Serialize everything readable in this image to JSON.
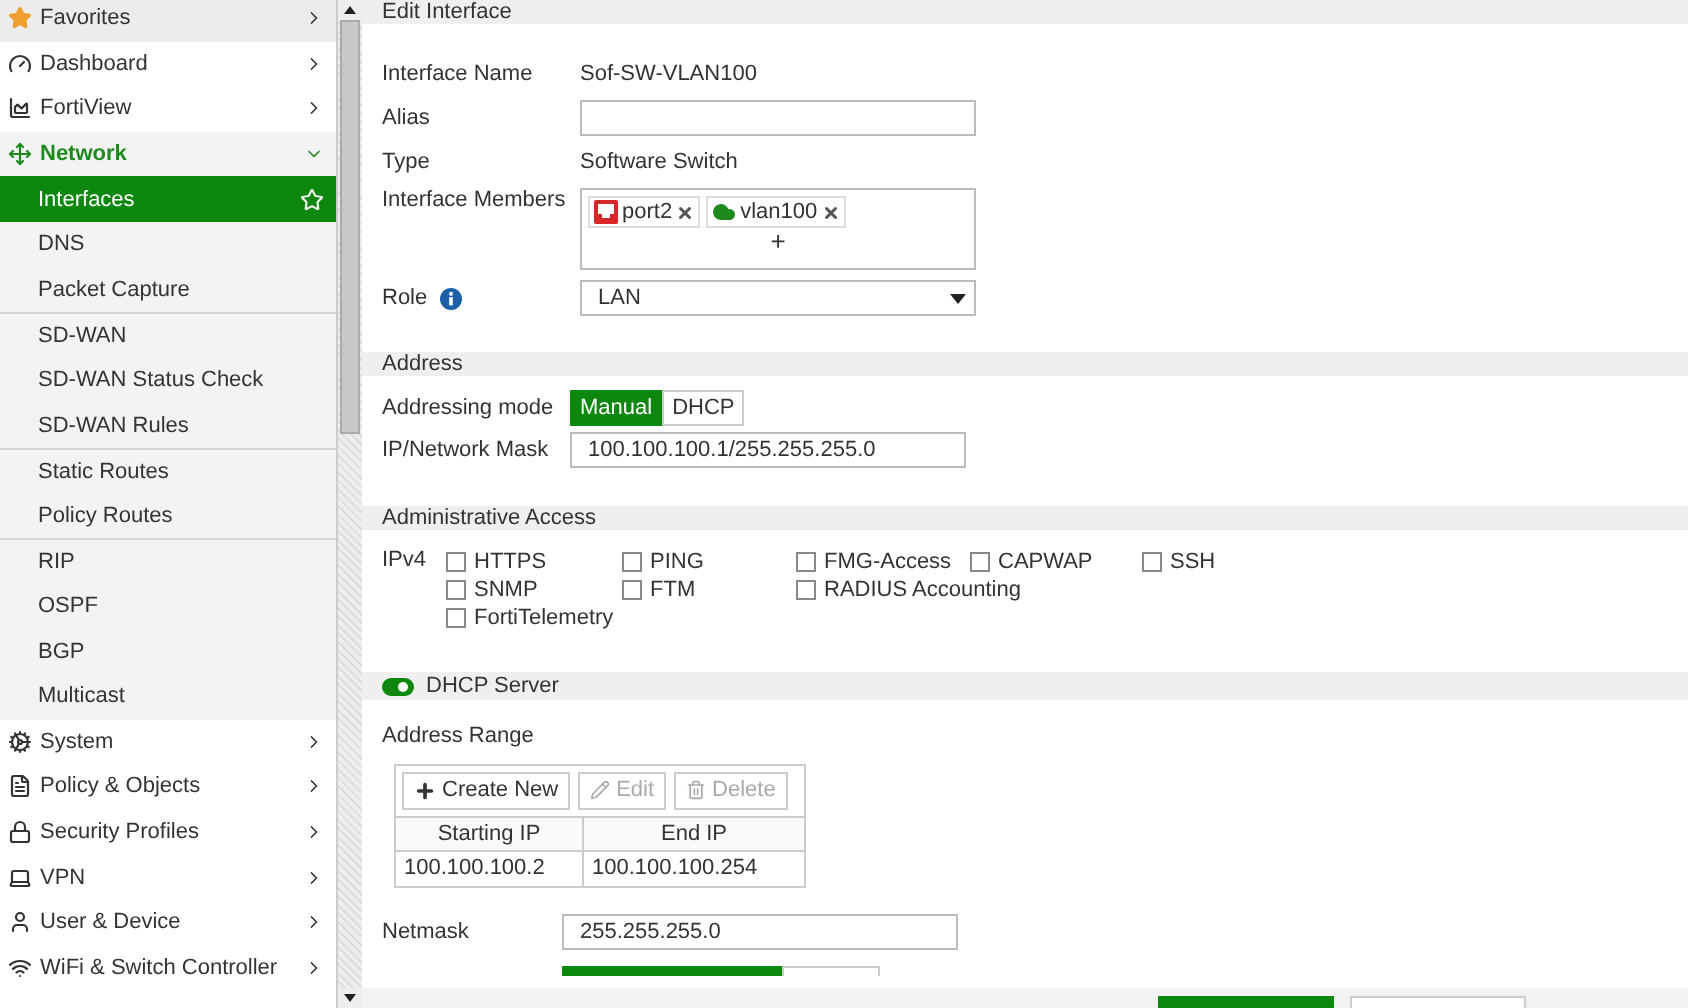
{
  "sidebar": {
    "items": [
      {
        "label": "Favorites",
        "kind": "favorites",
        "expanded": false
      },
      {
        "label": "Dashboard",
        "kind": "menu",
        "expanded": false
      },
      {
        "label": "FortiView",
        "kind": "menu",
        "expanded": false
      },
      {
        "label": "Network",
        "kind": "menu",
        "expanded": true,
        "children": [
          {
            "label": "Interfaces",
            "selected": true,
            "divider_before": false
          },
          {
            "label": "DNS",
            "selected": false,
            "divider_before": false
          },
          {
            "label": "Packet Capture",
            "selected": false,
            "divider_before": false
          },
          {
            "label": "SD-WAN",
            "selected": false,
            "divider_before": true
          },
          {
            "label": "SD-WAN Status Check",
            "selected": false,
            "divider_before": false
          },
          {
            "label": "SD-WAN Rules",
            "selected": false,
            "divider_before": false
          },
          {
            "label": "Static Routes",
            "selected": false,
            "divider_before": true
          },
          {
            "label": "Policy Routes",
            "selected": false,
            "divider_before": false
          },
          {
            "label": "RIP",
            "selected": false,
            "divider_before": true
          },
          {
            "label": "OSPF",
            "selected": false,
            "divider_before": false
          },
          {
            "label": "BGP",
            "selected": false,
            "divider_before": false
          },
          {
            "label": "Multicast",
            "selected": false,
            "divider_before": false
          }
        ]
      },
      {
        "label": "System",
        "kind": "menu",
        "expanded": false
      },
      {
        "label": "Policy & Objects",
        "kind": "menu",
        "expanded": false
      },
      {
        "label": "Security Profiles",
        "kind": "menu",
        "expanded": false
      },
      {
        "label": "VPN",
        "kind": "menu",
        "expanded": false
      },
      {
        "label": "User & Device",
        "kind": "menu",
        "expanded": false
      },
      {
        "label": "WiFi & Switch Controller",
        "kind": "menu",
        "expanded": false
      }
    ]
  },
  "edit_interface": {
    "title": "Edit Interface",
    "interface_name": {
      "label": "Interface Name",
      "value": "Sof-SW-VLAN100"
    },
    "alias": {
      "label": "Alias"
    },
    "type": {
      "label": "Type",
      "value": "Software Switch"
    },
    "members": {
      "label": "Interface Members",
      "items": [
        {
          "name": "port2",
          "kind": "physical"
        },
        {
          "name": "vlan100",
          "kind": "vlan"
        }
      ],
      "add": "+"
    },
    "role": {
      "label": "Role",
      "value": "LAN"
    }
  },
  "address": {
    "title": "Address",
    "addressing_mode": {
      "label": "Addressing mode",
      "options": [
        {
          "label": "Manual",
          "selected": true
        },
        {
          "label": "DHCP",
          "selected": false
        }
      ]
    },
    "ip_mask": {
      "label": "IP/Network Mask",
      "value": "100.100.100.1/255.255.255.0"
    }
  },
  "administrative_access": {
    "title": "Administrative Access",
    "protocol": "IPv4",
    "rows": [
      [
        {
          "label": "HTTPS",
          "checked": false
        },
        {
          "label": "PING",
          "checked": false
        },
        {
          "label": "FMG-Access",
          "checked": false
        },
        {
          "label": "CAPWAP",
          "checked": false
        },
        {
          "label": "SSH",
          "checked": false
        }
      ],
      [
        {
          "label": "SNMP",
          "checked": false
        },
        {
          "label": "FTM",
          "checked": false
        },
        {
          "label": "RADIUS Accounting",
          "checked": false
        }
      ],
      [
        {
          "label": "FortiTelemetry",
          "checked": false
        }
      ]
    ]
  },
  "dhcp_server": {
    "title": "DHCP Server",
    "on": true,
    "address_range": {
      "label": "Address Range",
      "toolbar": [
        {
          "label": "Create New",
          "kind": "create",
          "disabled": false
        },
        {
          "label": "Edit",
          "kind": "edit",
          "disabled": true
        },
        {
          "label": "Delete",
          "kind": "delete",
          "disabled": true
        }
      ],
      "columns": [
        "Starting IP",
        "End IP"
      ],
      "rows": [
        [
          "100.100.100.2",
          "100.100.100.254"
        ]
      ]
    },
    "netmask": {
      "label": "Netmask",
      "value": "255.255.255.0"
    }
  }
}
